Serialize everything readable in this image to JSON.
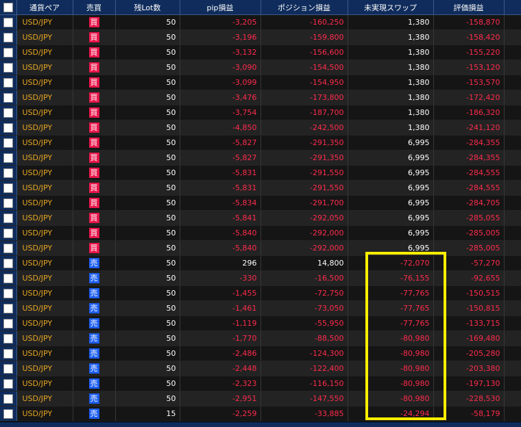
{
  "columns": [
    "通貨ペア",
    "売買",
    "残Lot数",
    "pip損益",
    "ポジション損益",
    "未実現スワップ",
    "評価損益"
  ],
  "badge_colors": {
    "買": "#e8154a",
    "売": "#1d5ef0"
  },
  "rows": [
    {
      "pair": "USD/JPY",
      "side": "買",
      "lots": "50",
      "pip": "-3,205",
      "position": "-160,250",
      "swap": "1,380",
      "valuation": "-158,870"
    },
    {
      "pair": "USD/JPY",
      "side": "買",
      "lots": "50",
      "pip": "-3,196",
      "position": "-159,800",
      "swap": "1,380",
      "valuation": "-158,420"
    },
    {
      "pair": "USD/JPY",
      "side": "買",
      "lots": "50",
      "pip": "-3,132",
      "position": "-156,600",
      "swap": "1,380",
      "valuation": "-155,220"
    },
    {
      "pair": "USD/JPY",
      "side": "買",
      "lots": "50",
      "pip": "-3,090",
      "position": "-154,500",
      "swap": "1,380",
      "valuation": "-153,120"
    },
    {
      "pair": "USD/JPY",
      "side": "買",
      "lots": "50",
      "pip": "-3,099",
      "position": "-154,950",
      "swap": "1,380",
      "valuation": "-153,570"
    },
    {
      "pair": "USD/JPY",
      "side": "買",
      "lots": "50",
      "pip": "-3,476",
      "position": "-173,800",
      "swap": "1,380",
      "valuation": "-172,420"
    },
    {
      "pair": "USD/JPY",
      "side": "買",
      "lots": "50",
      "pip": "-3,754",
      "position": "-187,700",
      "swap": "1,380",
      "valuation": "-186,320"
    },
    {
      "pair": "USD/JPY",
      "side": "買",
      "lots": "50",
      "pip": "-4,850",
      "position": "-242,500",
      "swap": "1,380",
      "valuation": "-241,120"
    },
    {
      "pair": "USD/JPY",
      "side": "買",
      "lots": "50",
      "pip": "-5,827",
      "position": "-291,350",
      "swap": "6,995",
      "valuation": "-284,355"
    },
    {
      "pair": "USD/JPY",
      "side": "買",
      "lots": "50",
      "pip": "-5,827",
      "position": "-291,350",
      "swap": "6,995",
      "valuation": "-284,355"
    },
    {
      "pair": "USD/JPY",
      "side": "買",
      "lots": "50",
      "pip": "-5,831",
      "position": "-291,550",
      "swap": "6,995",
      "valuation": "-284,555"
    },
    {
      "pair": "USD/JPY",
      "side": "買",
      "lots": "50",
      "pip": "-5,831",
      "position": "-291,550",
      "swap": "6,995",
      "valuation": "-284,555"
    },
    {
      "pair": "USD/JPY",
      "side": "買",
      "lots": "50",
      "pip": "-5,834",
      "position": "-291,700",
      "swap": "6,995",
      "valuation": "-284,705"
    },
    {
      "pair": "USD/JPY",
      "side": "買",
      "lots": "50",
      "pip": "-5,841",
      "position": "-292,050",
      "swap": "6,995",
      "valuation": "-285,055"
    },
    {
      "pair": "USD/JPY",
      "side": "買",
      "lots": "50",
      "pip": "-5,840",
      "position": "-292,000",
      "swap": "6,995",
      "valuation": "-285,005"
    },
    {
      "pair": "USD/JPY",
      "side": "買",
      "lots": "50",
      "pip": "-5,840",
      "position": "-292,000",
      "swap": "6,995",
      "valuation": "-285,005"
    },
    {
      "pair": "USD/JPY",
      "side": "売",
      "lots": "50",
      "pip": "296",
      "position": "14,800",
      "swap": "-72,070",
      "valuation": "-57,270"
    },
    {
      "pair": "USD/JPY",
      "side": "売",
      "lots": "50",
      "pip": "-330",
      "position": "-16,500",
      "swap": "-76,155",
      "valuation": "-92,655"
    },
    {
      "pair": "USD/JPY",
      "side": "売",
      "lots": "50",
      "pip": "-1,455",
      "position": "-72,750",
      "swap": "-77,765",
      "valuation": "-150,515"
    },
    {
      "pair": "USD/JPY",
      "side": "売",
      "lots": "50",
      "pip": "-1,461",
      "position": "-73,050",
      "swap": "-77,765",
      "valuation": "-150,815"
    },
    {
      "pair": "USD/JPY",
      "side": "売",
      "lots": "50",
      "pip": "-1,119",
      "position": "-55,950",
      "swap": "-77,765",
      "valuation": "-133,715"
    },
    {
      "pair": "USD/JPY",
      "side": "売",
      "lots": "50",
      "pip": "-1,770",
      "position": "-88,500",
      "swap": "-80,980",
      "valuation": "-169,480"
    },
    {
      "pair": "USD/JPY",
      "side": "売",
      "lots": "50",
      "pip": "-2,486",
      "position": "-124,300",
      "swap": "-80,980",
      "valuation": "-205,280"
    },
    {
      "pair": "USD/JPY",
      "side": "売",
      "lots": "50",
      "pip": "-2,448",
      "position": "-122,400",
      "swap": "-80,980",
      "valuation": "-203,380"
    },
    {
      "pair": "USD/JPY",
      "side": "売",
      "lots": "50",
      "pip": "-2,323",
      "position": "-116,150",
      "swap": "-80,980",
      "valuation": "-197,130"
    },
    {
      "pair": "USD/JPY",
      "side": "売",
      "lots": "50",
      "pip": "-2,951",
      "position": "-147,550",
      "swap": "-80,980",
      "valuation": "-228,530"
    },
    {
      "pair": "USD/JPY",
      "side": "売",
      "lots": "15",
      "pip": "-2,259",
      "position": "-33,885",
      "swap": "-24,294",
      "valuation": "-58,179"
    }
  ]
}
